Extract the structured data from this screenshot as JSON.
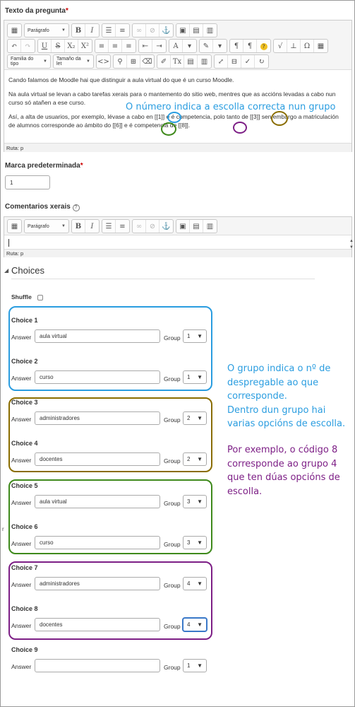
{
  "question_text": {
    "label": "Texto da pregunta",
    "required_mark": "*",
    "toolbar": {
      "row1": {
        "paragraph_select": "Parágrafo"
      },
      "row2": {
        "font_family_select": "Familia do tipo",
        "font_size_select": "Tamaño da let"
      }
    },
    "content": {
      "p1": "Cando falamos de Moodle hai que distinguir a aula virtual do que é un curso Moodle.",
      "p2": "Na aula virtual se levan a cabo tarefas xerais para o mantemento do sitio web, mentres que as accións levadas a cabo nun curso só atañen a ese curso.",
      "p3_line1_a": "Así, a alta de usuarios, por exemplo, lévase a cabo en",
      "p3_code1": "[[1]]",
      "p3_line1_b": "e é competencia, polo tanto de",
      "p3_code2": "[[3]]",
      "p3_line1_c": "sen embargo a",
      "p3_line2_a": "matriculación de alumnos corresponde ao ámbito do",
      "p3_code3": "[[6]]",
      "p3_line2_b": "e é competencia de",
      "p3_code4": "[[8]]",
      "p3_line2_c": "."
    },
    "path": "Ruta: p"
  },
  "default_mark": {
    "label": "Marca predeterminada",
    "required_mark": "*",
    "value": "1"
  },
  "general_feedback": {
    "label": "Comentarios xerais",
    "help_icon": "question-circle-icon",
    "toolbar_select": "Parágrafo",
    "path": "Ruta: p"
  },
  "choices_section": {
    "title": "Choices",
    "shuffle_label": "Shuffle",
    "answer_label": "Answer",
    "group_label": "Group",
    "choices": [
      {
        "title": "Choice 1",
        "answer": "aula virtual",
        "group": "1"
      },
      {
        "title": "Choice 2",
        "answer": "curso",
        "group": "1"
      },
      {
        "title": "Choice 3",
        "answer": "administradores",
        "group": "2"
      },
      {
        "title": "Choice 4",
        "answer": "docentes",
        "group": "2"
      },
      {
        "title": "Choice 5",
        "answer": "aula virtual",
        "group": "3"
      },
      {
        "title": "Choice 6",
        "answer": "curso",
        "group": "3"
      },
      {
        "title": "Choice 7",
        "answer": "administradores",
        "group": "4"
      },
      {
        "title": "Choice 8",
        "answer": "docentes",
        "group": "4"
      },
      {
        "title": "Choice 9",
        "answer": "",
        "group": "1"
      }
    ]
  },
  "annotations": {
    "number_note": "O número indica a escolla correcta nun grupo",
    "group_note_1": "O grupo indica o nº de",
    "group_note_2": "despregable ao que",
    "group_note_3": "corresponde.",
    "group_note_4": "Dentro dun grupo hai",
    "group_note_5": "varias opcións de escolla.",
    "example_note_1": "Por exemplo, o código 8",
    "example_note_2": "corresponde ao grupo 4",
    "example_note_3": "que ten dúas opcións de",
    "example_note_4": "escolla."
  },
  "colors": {
    "blue": "#2a9de0",
    "olive": "#8a6d00",
    "green": "#3f8a1c",
    "purple": "#7d1f86",
    "note_blue": "#2a9de0",
    "note_purple": "#7d1f86"
  }
}
